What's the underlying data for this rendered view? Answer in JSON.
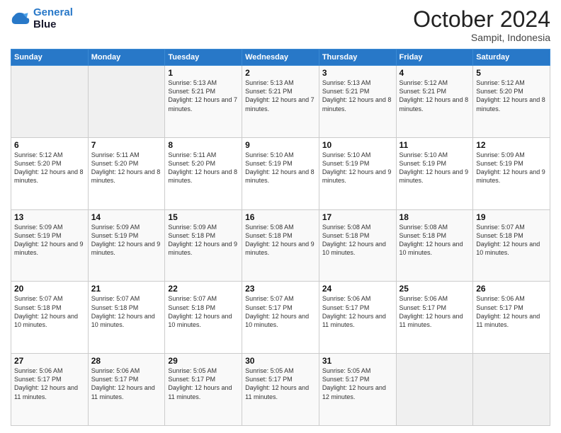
{
  "logo": {
    "line1": "General",
    "line2": "Blue"
  },
  "title": "October 2024",
  "location": "Sampit, Indonesia",
  "weekdays": [
    "Sunday",
    "Monday",
    "Tuesday",
    "Wednesday",
    "Thursday",
    "Friday",
    "Saturday"
  ],
  "weeks": [
    [
      {
        "day": "",
        "sunrise": "",
        "sunset": "",
        "daylight": ""
      },
      {
        "day": "",
        "sunrise": "",
        "sunset": "",
        "daylight": ""
      },
      {
        "day": "1",
        "sunrise": "Sunrise: 5:13 AM",
        "sunset": "Sunset: 5:21 PM",
        "daylight": "Daylight: 12 hours and 7 minutes."
      },
      {
        "day": "2",
        "sunrise": "Sunrise: 5:13 AM",
        "sunset": "Sunset: 5:21 PM",
        "daylight": "Daylight: 12 hours and 7 minutes."
      },
      {
        "day": "3",
        "sunrise": "Sunrise: 5:13 AM",
        "sunset": "Sunset: 5:21 PM",
        "daylight": "Daylight: 12 hours and 8 minutes."
      },
      {
        "day": "4",
        "sunrise": "Sunrise: 5:12 AM",
        "sunset": "Sunset: 5:21 PM",
        "daylight": "Daylight: 12 hours and 8 minutes."
      },
      {
        "day": "5",
        "sunrise": "Sunrise: 5:12 AM",
        "sunset": "Sunset: 5:20 PM",
        "daylight": "Daylight: 12 hours and 8 minutes."
      }
    ],
    [
      {
        "day": "6",
        "sunrise": "Sunrise: 5:12 AM",
        "sunset": "Sunset: 5:20 PM",
        "daylight": "Daylight: 12 hours and 8 minutes."
      },
      {
        "day": "7",
        "sunrise": "Sunrise: 5:11 AM",
        "sunset": "Sunset: 5:20 PM",
        "daylight": "Daylight: 12 hours and 8 minutes."
      },
      {
        "day": "8",
        "sunrise": "Sunrise: 5:11 AM",
        "sunset": "Sunset: 5:20 PM",
        "daylight": "Daylight: 12 hours and 8 minutes."
      },
      {
        "day": "9",
        "sunrise": "Sunrise: 5:10 AM",
        "sunset": "Sunset: 5:19 PM",
        "daylight": "Daylight: 12 hours and 8 minutes."
      },
      {
        "day": "10",
        "sunrise": "Sunrise: 5:10 AM",
        "sunset": "Sunset: 5:19 PM",
        "daylight": "Daylight: 12 hours and 9 minutes."
      },
      {
        "day": "11",
        "sunrise": "Sunrise: 5:10 AM",
        "sunset": "Sunset: 5:19 PM",
        "daylight": "Daylight: 12 hours and 9 minutes."
      },
      {
        "day": "12",
        "sunrise": "Sunrise: 5:09 AM",
        "sunset": "Sunset: 5:19 PM",
        "daylight": "Daylight: 12 hours and 9 minutes."
      }
    ],
    [
      {
        "day": "13",
        "sunrise": "Sunrise: 5:09 AM",
        "sunset": "Sunset: 5:19 PM",
        "daylight": "Daylight: 12 hours and 9 minutes."
      },
      {
        "day": "14",
        "sunrise": "Sunrise: 5:09 AM",
        "sunset": "Sunset: 5:19 PM",
        "daylight": "Daylight: 12 hours and 9 minutes."
      },
      {
        "day": "15",
        "sunrise": "Sunrise: 5:09 AM",
        "sunset": "Sunset: 5:18 PM",
        "daylight": "Daylight: 12 hours and 9 minutes."
      },
      {
        "day": "16",
        "sunrise": "Sunrise: 5:08 AM",
        "sunset": "Sunset: 5:18 PM",
        "daylight": "Daylight: 12 hours and 9 minutes."
      },
      {
        "day": "17",
        "sunrise": "Sunrise: 5:08 AM",
        "sunset": "Sunset: 5:18 PM",
        "daylight": "Daylight: 12 hours and 10 minutes."
      },
      {
        "day": "18",
        "sunrise": "Sunrise: 5:08 AM",
        "sunset": "Sunset: 5:18 PM",
        "daylight": "Daylight: 12 hours and 10 minutes."
      },
      {
        "day": "19",
        "sunrise": "Sunrise: 5:07 AM",
        "sunset": "Sunset: 5:18 PM",
        "daylight": "Daylight: 12 hours and 10 minutes."
      }
    ],
    [
      {
        "day": "20",
        "sunrise": "Sunrise: 5:07 AM",
        "sunset": "Sunset: 5:18 PM",
        "daylight": "Daylight: 12 hours and 10 minutes."
      },
      {
        "day": "21",
        "sunrise": "Sunrise: 5:07 AM",
        "sunset": "Sunset: 5:18 PM",
        "daylight": "Daylight: 12 hours and 10 minutes."
      },
      {
        "day": "22",
        "sunrise": "Sunrise: 5:07 AM",
        "sunset": "Sunset: 5:18 PM",
        "daylight": "Daylight: 12 hours and 10 minutes."
      },
      {
        "day": "23",
        "sunrise": "Sunrise: 5:07 AM",
        "sunset": "Sunset: 5:17 PM",
        "daylight": "Daylight: 12 hours and 10 minutes."
      },
      {
        "day": "24",
        "sunrise": "Sunrise: 5:06 AM",
        "sunset": "Sunset: 5:17 PM",
        "daylight": "Daylight: 12 hours and 11 minutes."
      },
      {
        "day": "25",
        "sunrise": "Sunrise: 5:06 AM",
        "sunset": "Sunset: 5:17 PM",
        "daylight": "Daylight: 12 hours and 11 minutes."
      },
      {
        "day": "26",
        "sunrise": "Sunrise: 5:06 AM",
        "sunset": "Sunset: 5:17 PM",
        "daylight": "Daylight: 12 hours and 11 minutes."
      }
    ],
    [
      {
        "day": "27",
        "sunrise": "Sunrise: 5:06 AM",
        "sunset": "Sunset: 5:17 PM",
        "daylight": "Daylight: 12 hours and 11 minutes."
      },
      {
        "day": "28",
        "sunrise": "Sunrise: 5:06 AM",
        "sunset": "Sunset: 5:17 PM",
        "daylight": "Daylight: 12 hours and 11 minutes."
      },
      {
        "day": "29",
        "sunrise": "Sunrise: 5:05 AM",
        "sunset": "Sunset: 5:17 PM",
        "daylight": "Daylight: 12 hours and 11 minutes."
      },
      {
        "day": "30",
        "sunrise": "Sunrise: 5:05 AM",
        "sunset": "Sunset: 5:17 PM",
        "daylight": "Daylight: 12 hours and 11 minutes."
      },
      {
        "day": "31",
        "sunrise": "Sunrise: 5:05 AM",
        "sunset": "Sunset: 5:17 PM",
        "daylight": "Daylight: 12 hours and 12 minutes."
      },
      {
        "day": "",
        "sunrise": "",
        "sunset": "",
        "daylight": ""
      },
      {
        "day": "",
        "sunrise": "",
        "sunset": "",
        "daylight": ""
      }
    ]
  ]
}
